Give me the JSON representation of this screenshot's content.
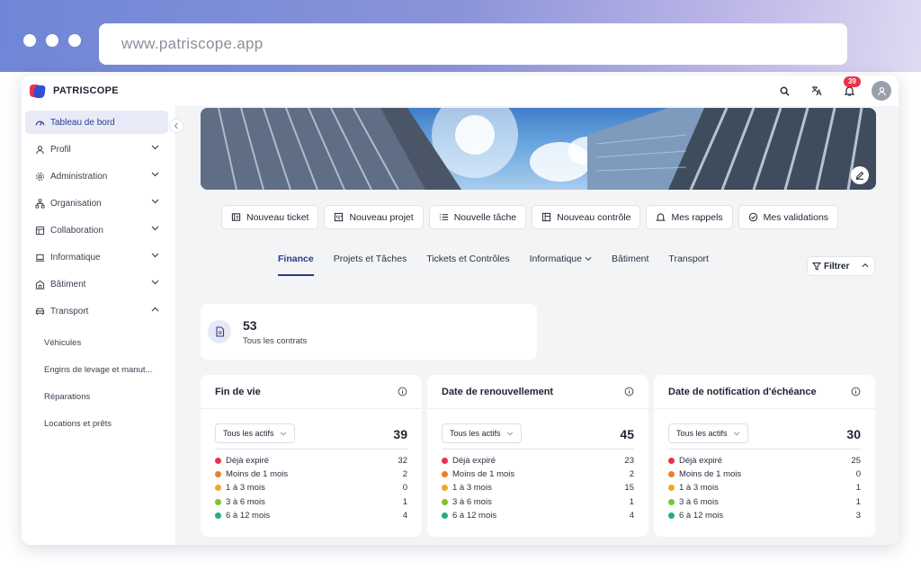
{
  "browser": {
    "url": "www.patriscope.app"
  },
  "app": {
    "name": "PATRISCOPE",
    "notifications_count": "39"
  },
  "icons": {
    "search": "search-icon",
    "translate": "translate-icon",
    "bell": "bell-icon",
    "user": "user-icon"
  },
  "colors": {
    "accent": "#2b3a8f",
    "danger": "#e8324b",
    "orange": "#f07e24",
    "amber": "#f2a52a",
    "lime": "#7cc432",
    "green": "#20b07a"
  },
  "sidebar": {
    "items": [
      {
        "label": "Tableau de bord",
        "icon": "dashboard-icon",
        "active": true
      },
      {
        "label": "Profil",
        "icon": "user-icon"
      },
      {
        "label": "Administration",
        "icon": "gear-icon"
      },
      {
        "label": "Organisation",
        "icon": "org-chart-icon"
      },
      {
        "label": "Collaboration",
        "icon": "board-icon"
      },
      {
        "label": "Informatique",
        "icon": "laptop-icon"
      },
      {
        "label": "Bâtiment",
        "icon": "building-icon"
      },
      {
        "label": "Transport",
        "icon": "car-icon"
      }
    ],
    "transport_sub": [
      "Véhicules",
      "Engins de levage et manut...",
      "Réparations",
      "Locations et prêts"
    ]
  },
  "actions": [
    {
      "label": "Nouveau ticket",
      "icon": "ticket-icon"
    },
    {
      "label": "Nouveau projet",
      "icon": "project-icon"
    },
    {
      "label": "Nouvelle tâche",
      "icon": "list-icon"
    },
    {
      "label": "Nouveau contrôle",
      "icon": "control-icon"
    },
    {
      "label": "Mes rappels",
      "icon": "bell-icon"
    },
    {
      "label": "Mes validations",
      "icon": "check-circle-icon"
    }
  ],
  "tabs": [
    {
      "label": "Finance",
      "active": true
    },
    {
      "label": "Projets et Tâches"
    },
    {
      "label": "Tickets et Contrôles"
    },
    {
      "label": "Informatique",
      "dropdown": true
    },
    {
      "label": "Bâtiment"
    },
    {
      "label": "Transport"
    }
  ],
  "filter_label": "Filtrer",
  "contracts": {
    "count": "53",
    "label": "Tous les contrats"
  },
  "cards": [
    {
      "title": "Fin de vie",
      "select": "Tous les actifs",
      "total": "39",
      "rows": [
        {
          "label": "Déjà expiré",
          "value": "32"
        },
        {
          "label": "Moins de 1 mois",
          "value": "2"
        },
        {
          "label": "1 à 3 mois",
          "value": "0"
        },
        {
          "label": "3 à 6 mois",
          "value": "1"
        },
        {
          "label": "6 à 12 mois",
          "value": "4"
        }
      ]
    },
    {
      "title": "Date de renouvellement",
      "select": "Tous les actifs",
      "total": "45",
      "rows": [
        {
          "label": "Déjà expiré",
          "value": "23"
        },
        {
          "label": "Moins de 1 mois",
          "value": "2"
        },
        {
          "label": "1 à 3 mois",
          "value": "15"
        },
        {
          "label": "3 à 6 mois",
          "value": "1"
        },
        {
          "label": "6 à 12 mois",
          "value": "4"
        }
      ]
    },
    {
      "title": "Date de notification d'échéance",
      "select": "Tous les actifs",
      "total": "30",
      "rows": [
        {
          "label": "Déjà expiré",
          "value": "25"
        },
        {
          "label": "Moins de 1 mois",
          "value": "0"
        },
        {
          "label": "1 à 3 mois",
          "value": "1"
        },
        {
          "label": "3 à 6 mois",
          "value": "1"
        },
        {
          "label": "6 à 12 mois",
          "value": "3"
        }
      ]
    }
  ]
}
